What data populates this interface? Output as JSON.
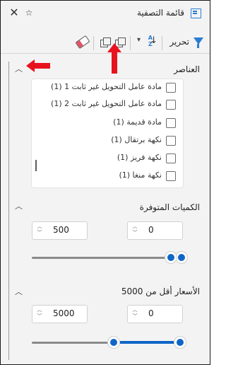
{
  "window": {
    "title": "قائمة التصفية",
    "close_glyph": "✕",
    "pin_glyph": "☆"
  },
  "toolbar": {
    "edit_label": "تحرير",
    "sort_glyph": "A\nZ",
    "icons": [
      "filter-icon",
      "sort-icon",
      "chevron-down-icon",
      "copy-icon",
      "paste-icon",
      "eraser-icon"
    ]
  },
  "elements": {
    "title": "العناصر",
    "items": [
      {
        "label": "مادة عامل التحويل غير ثابت 1 (1)",
        "checked": false
      },
      {
        "label": "مادة عامل التحويل غير ثابت 2 (1)",
        "checked": false
      },
      {
        "label": "مادة قديمة (1)",
        "checked": false
      },
      {
        "label": "نكهة برتقال (1)",
        "checked": false
      },
      {
        "label": "نكهة فريز (1)",
        "checked": false
      },
      {
        "label": "نكهة منغا (1)",
        "checked": false
      }
    ]
  },
  "quantities": {
    "title": "الكميات المتوفرة",
    "min_value": "0",
    "max_value": "500"
  },
  "prices": {
    "title": "الأسعار أقل من 5000",
    "min_value": "0",
    "max_value": "5000"
  },
  "colors": {
    "accent": "#1066c6",
    "annotation": "#e8121d",
    "track_inactive": "#8a8a8a"
  }
}
